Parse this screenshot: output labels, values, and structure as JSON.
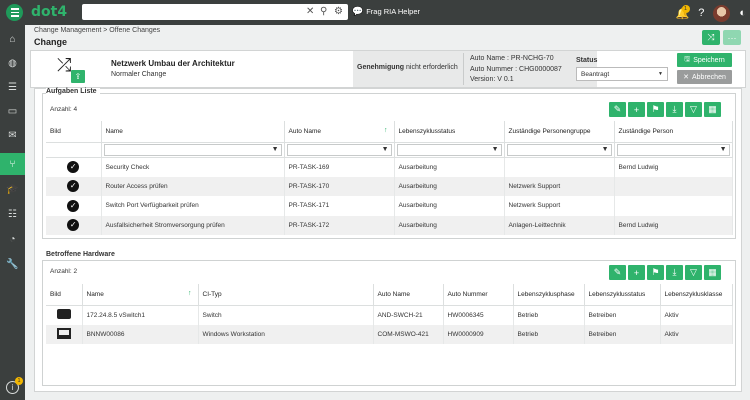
{
  "app": {
    "logo": "dot4",
    "help_link": "Frag RIA Helper",
    "notification_count": "1",
    "info_count": "1"
  },
  "search": {
    "value": "",
    "placeholder": ""
  },
  "breadcrumb": "Change Management > Offene Changes",
  "page_title": "Change",
  "header": {
    "title": "Netzwerk Umbau der Architektur",
    "subtitle": "Normaler Change",
    "approval_label": "Genehmigung",
    "approval_value": "nicht erforderlich",
    "auto_name": "Auto Name : PR-NCHG-70",
    "auto_number": "Auto Nummer : CHG0000087",
    "version": "Version: V 0.1",
    "status_label": "Status",
    "status_value": "Beantragt",
    "save_label": "Speichern",
    "cancel_label": "Abbrechen"
  },
  "tasks": {
    "title": "Aufgaben Liste",
    "count": "Anzahl: 4",
    "columns": [
      "Bild",
      "Name",
      "Auto Name",
      "Lebenszyklusstatus",
      "Zuständige Personengruppe",
      "Zuständige Person"
    ],
    "rows": [
      [
        "Security Check",
        "PR-TASK-169",
        "Ausarbeitung",
        "",
        "Bernd Ludwig"
      ],
      [
        "Router Access prüfen",
        "PR-TASK-170",
        "Ausarbeitung",
        "Netzwerk Support",
        ""
      ],
      [
        "Switch Port Verfügbarkeit prüfen",
        "PR-TASK-171",
        "Ausarbeitung",
        "Netzwerk Support",
        ""
      ],
      [
        "Ausfallsicherheit Stromversorgung prüfen",
        "PR-TASK-172",
        "Ausarbeitung",
        "Anlagen-Leittechnik",
        "Bernd Ludwig"
      ]
    ]
  },
  "hardware": {
    "title": "Betroffene Hardware",
    "count": "Anzahl: 2",
    "columns": [
      "Bild",
      "Name",
      "CI-Typ",
      "Auto Name",
      "Auto Nummer",
      "Lebenszyklusphase",
      "Lebenszyklusstatus",
      "Lebenszyklusklasse"
    ],
    "rows": [
      [
        "172.24.8.5 vSwitch1",
        "Switch",
        "AND-SWCH-21",
        "HW0006345",
        "Betrieb",
        "Betreiben",
        "Aktiv"
      ],
      [
        "BNNW00086",
        "Windows Workstation",
        "COM-MSWO-421",
        "HW0000909",
        "Betrieb",
        "Betreiben",
        "Aktiv"
      ]
    ]
  },
  "colors": {
    "accent": "#2fb36c",
    "topbar": "#3b3f3e"
  }
}
